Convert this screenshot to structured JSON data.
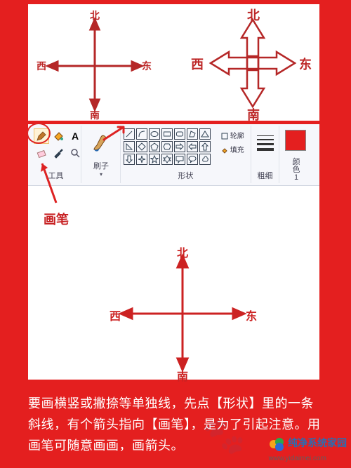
{
  "compass": {
    "north": "北",
    "south": "南",
    "east": "东",
    "west": "西"
  },
  "ribbon": {
    "tools_label": "工具",
    "brush_label": "刷子",
    "shapes_label": "形状",
    "size_label": "粗细",
    "color1_label": "颜\n色\n1",
    "text_tool": "A",
    "shape_opts": {
      "outline": "轮廓",
      "fill": "填充"
    }
  },
  "callouts": {
    "brush_pointer": "画笔"
  },
  "caption_text": "要画横竖或撇捺等单独线，先点【形状】里的一条斜线，有个箭头指向【画笔】，是为了引起注意。用画笔可随意画画，画箭头。",
  "watermark": {
    "brand": "纯净系统家园",
    "url": "www.yidaimei.com"
  }
}
